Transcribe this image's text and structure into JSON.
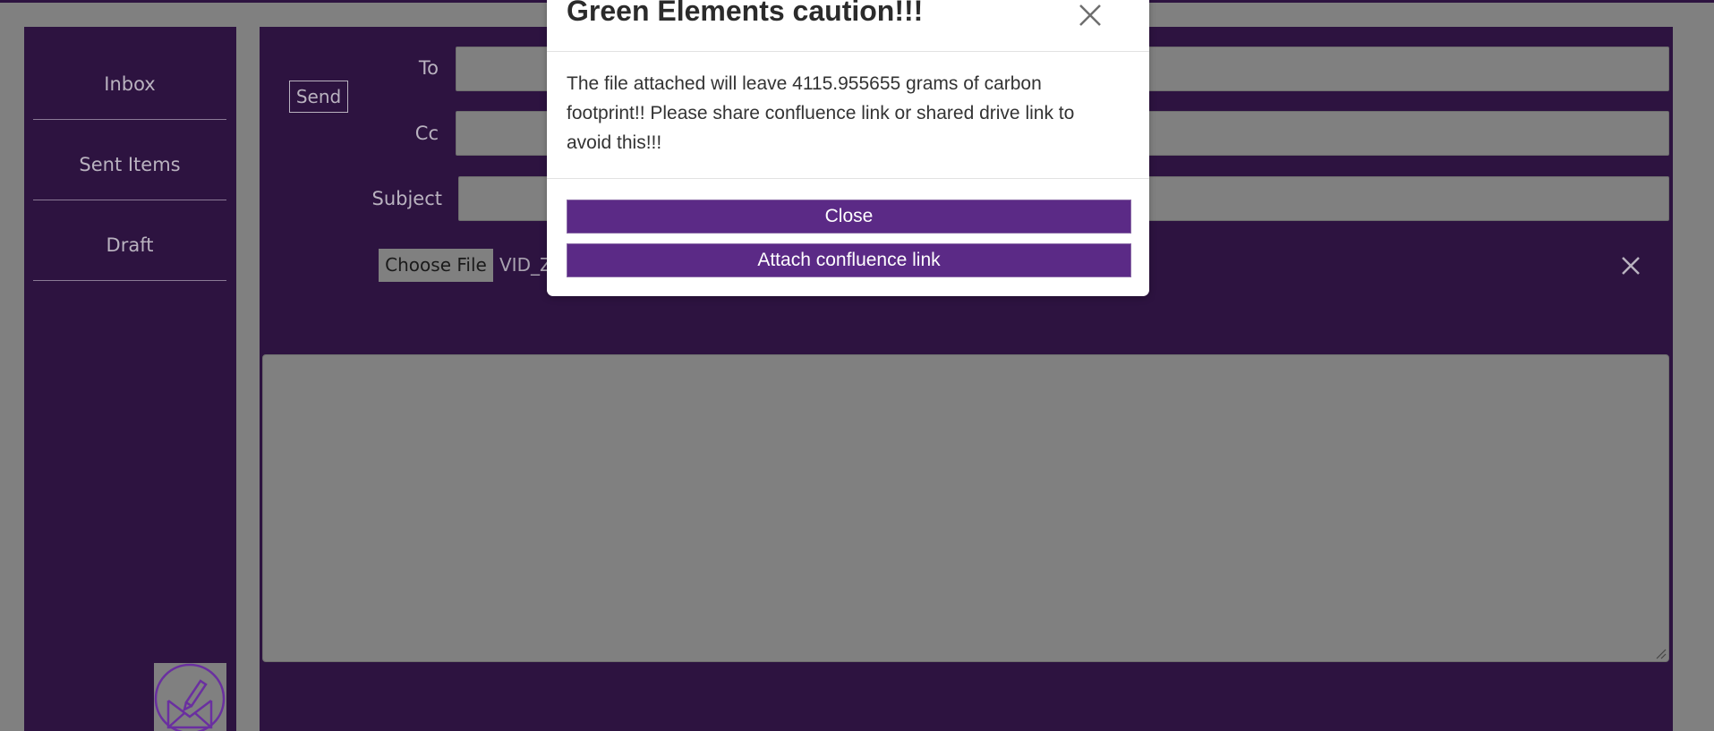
{
  "sidebar": {
    "items": [
      {
        "label": "Inbox"
      },
      {
        "label": "Sent Items"
      },
      {
        "label": "Draft"
      }
    ]
  },
  "compose": {
    "send_label": "Send",
    "to_label": "To",
    "cc_label": "Cc",
    "subject_label": "Subject",
    "to_value": "",
    "cc_value": "",
    "subject_value": "",
    "choose_file_label": "Choose File",
    "file_name": "VID_Z",
    "body_value": ""
  },
  "modal": {
    "title": "Green Elements caution!!!",
    "message": "The file attached will leave 4115.955655 grams of carbon footprint!! Please share confluence link or shared drive link to avoid this!!!",
    "close_button_label": "Close",
    "attach_link_button_label": "Attach confluence link"
  },
  "icons": {
    "compose": "compose-mail-icon",
    "remove_file": "close-icon",
    "modal_close": "close-icon"
  },
  "colors": {
    "panel": "#2d1340",
    "overlay_gray": "#808080",
    "accent_purple": "#5b2a86",
    "muted_text": "#b9b2bf"
  }
}
